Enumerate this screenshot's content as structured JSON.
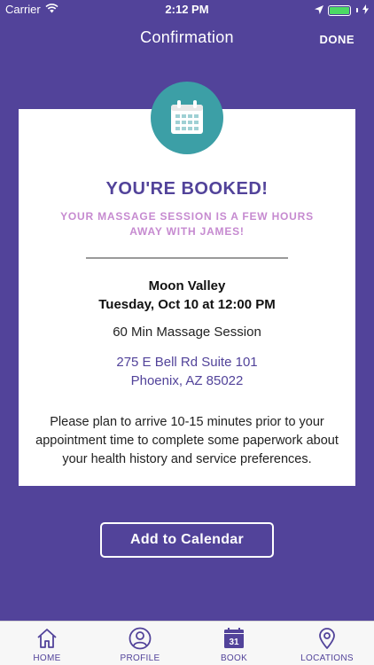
{
  "status_bar": {
    "carrier": "Carrier",
    "time": "2:12 PM",
    "battery_color": "#4cd964"
  },
  "nav": {
    "title": "Confirmation",
    "done_label": "DONE"
  },
  "card": {
    "icon": "calendar-icon",
    "heading": "YOU'RE BOOKED!",
    "subheading": "YOUR MASSAGE SESSION IS A FEW HOURS AWAY WITH JAMES!",
    "location_name": "Moon Valley",
    "datetime": "Tuesday, Oct 10 at 12:00 PM",
    "service": "60 Min Massage Session",
    "address_line1": "275 E Bell Rd Suite 101",
    "address_line2": "Phoenix, AZ 85022",
    "note": "Please plan to arrive 10-15 minutes prior to your appointment time to complete some paperwork about your health history and service preferences."
  },
  "actions": {
    "add_to_calendar": "Add to Calendar"
  },
  "tab_bar": {
    "items": [
      {
        "label": "HOME",
        "icon": "home-icon"
      },
      {
        "label": "PROFILE",
        "icon": "profile-icon"
      },
      {
        "label": "BOOK",
        "icon": "calendar-icon",
        "icon_text": "31"
      },
      {
        "label": "LOCATIONS",
        "icon": "location-pin-icon"
      }
    ]
  },
  "colors": {
    "background": "#52439a",
    "badge": "#3c9fa6",
    "accent_pink": "#c68ad0",
    "tab_bar": "#f7f7f7"
  }
}
